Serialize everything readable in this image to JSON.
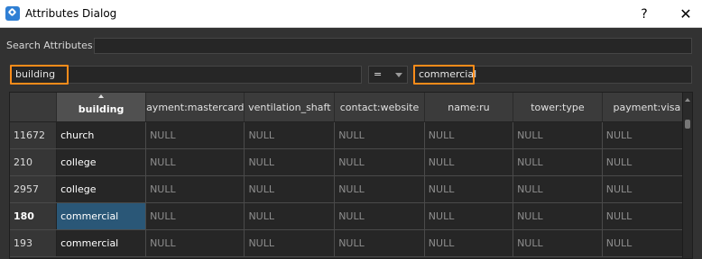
{
  "window": {
    "title": "Attributes Dialog",
    "help_label": "?",
    "close_label": "✕"
  },
  "search": {
    "label": "Search Attributes:",
    "value": ""
  },
  "filter": {
    "attribute": "building",
    "operator": "=",
    "value": "commercial"
  },
  "table": {
    "sorted_column": "building",
    "columns": [
      "building",
      "ayment:mastercard",
      "ventilation_shaft",
      "contact:website",
      "name:ru",
      "tower:type",
      "payment:visa"
    ],
    "rows": [
      {
        "id": "11672",
        "building": "church",
        "cells": [
          "NULL",
          "NULL",
          "NULL",
          "NULL",
          "NULL",
          "NULL"
        ]
      },
      {
        "id": "210",
        "building": "college",
        "cells": [
          "NULL",
          "NULL",
          "NULL",
          "NULL",
          "NULL",
          "NULL"
        ]
      },
      {
        "id": "2957",
        "building": "college",
        "cells": [
          "NULL",
          "NULL",
          "NULL",
          "NULL",
          "NULL",
          "NULL"
        ]
      },
      {
        "id": "180",
        "building": "commercial",
        "cells": [
          "NULL",
          "NULL",
          "NULL",
          "NULL",
          "NULL",
          "NULL"
        ]
      },
      {
        "id": "193",
        "building": "commercial",
        "cells": [
          "NULL",
          "NULL",
          "NULL",
          "NULL",
          "NULL",
          "NULL"
        ]
      }
    ],
    "selected_row_index": 3
  },
  "colors": {
    "highlight_outline": "#ff8c1a",
    "selection": "#2a5777",
    "title_icon": "#2f7fd4"
  }
}
